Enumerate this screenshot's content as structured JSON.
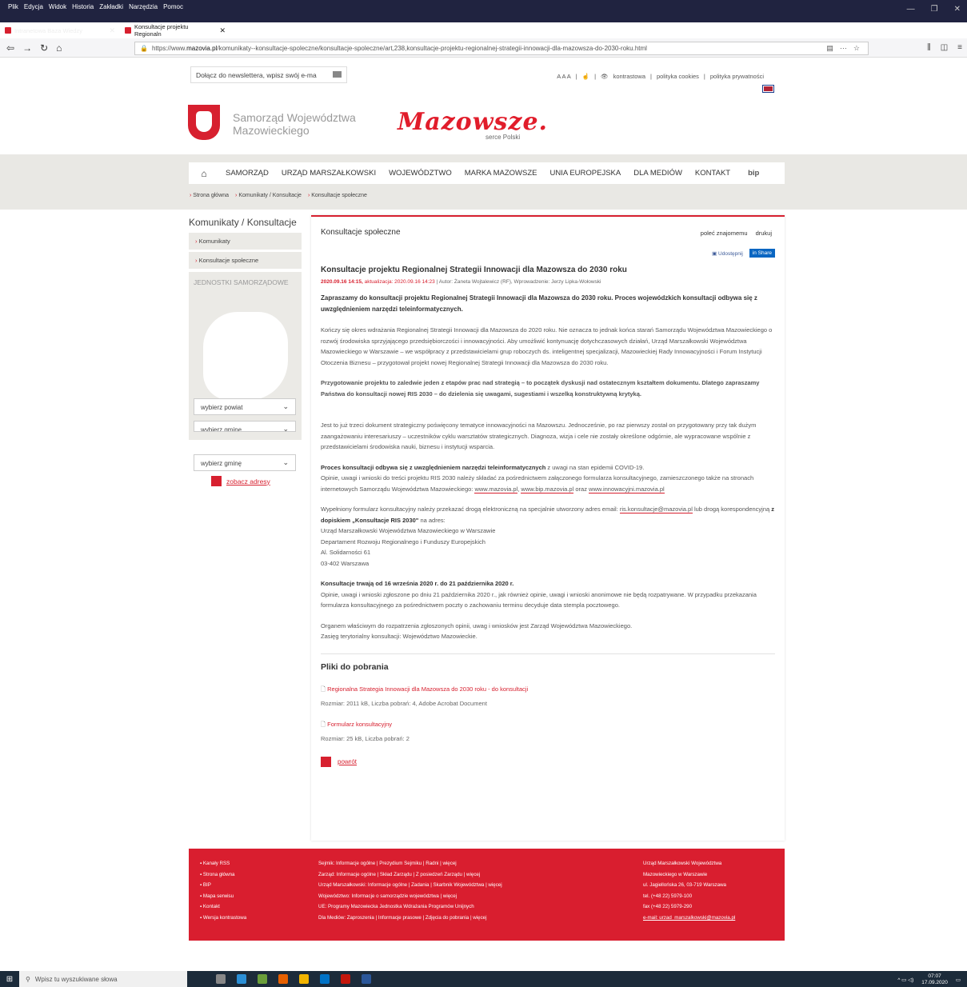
{
  "browser": {
    "menu": [
      "Plik",
      "Edycja",
      "Widok",
      "Historia",
      "Zakładki",
      "Narzędzia",
      "Pomoc"
    ],
    "tabs": [
      {
        "title": "Intranetowa Baza Wiedzy"
      },
      {
        "title": "Konsultacje projektu Regionaln"
      }
    ],
    "url_prefix": "https://www.",
    "url_host": "mazovia.pl",
    "url_rest": "/komunikaty--konsultacje-spoleczne/konsultacje-spoleczne/art,238,konsultacje-projektu-regionalnej-strategii-innowacji-dla-mazowsza-do-2030-roku.html"
  },
  "topbar": {
    "newsletter_placeholder": "Dołącz do newslettera, wpisz swój e-ma",
    "font_sizes": "A A A",
    "contrast": "kontrastowa",
    "cookies": "polityka cookies",
    "privacy": "polityka prywatności"
  },
  "logo": {
    "line1": "Samorząd Województwa",
    "line2": "Mazowieckiego",
    "brand": "Mazowsze.",
    "tagline": "serce Polski"
  },
  "mainmenu": [
    "SAMORZĄD",
    "URZĄD MARSZAŁKOWSKI",
    "WOJEWÓDZTWO",
    "MARKA MAZOWSZE",
    "UNIA EUROPEJSKA",
    "DLA MEDIÓW",
    "KONTAKT"
  ],
  "mainmenu_bip": "bip",
  "breadcrumb": [
    "Strona główna",
    "Komunikaty / Konsultacje",
    "Konsultacje społeczne"
  ],
  "sidebar": {
    "title": "Komunikaty / Konsultacje",
    "items": [
      "Komunikaty",
      "Konsultacje społeczne"
    ],
    "units_title": "JEDNOSTKI SAMORZĄDOWE",
    "select_powiat": "wybierz powiat",
    "select_gmina": "wybierz gminę",
    "show_addresses": "zobacz adresy"
  },
  "article": {
    "section": "Konsultacje społeczne",
    "recommend": "poleć znajomemu",
    "print": "drukuj",
    "fb_share": "Udostępnij",
    "li_share": "Share",
    "title": "Konsultacje projektu Regionalnej Strategii Innowacji dla Mazowsza do 2030 roku",
    "date": "2020.09.16 14:15,",
    "updated": "aktualizacja: 2020.09.16 14:23",
    "author": "| Autor: Żaneta Wojtalewicz (RF), Wprowadzenie: Jerzy Lipka-Wołowski",
    "lead": "Zapraszamy do konsultacji projektu Regionalnej Strategii Innowacji dla Mazowsza do 2030 roku. Proces wojewódzkich konsultacji odbywa się z uwzględnieniem narzędzi teleinformatycznych.",
    "p1": "Kończy się okres wdrażania Regionalnej Strategii Innowacji dla Mazowsza do 2020 roku. Nie oznacza to jednak końca starań Samorządu Województwa Mazowieckiego o rozwój środowiska sprzyjającego przedsiębiorczości i innowacyjności. Aby umożliwić kontynuację dotychczasowych działań, Urząd Marszałkowski Województwa Mazowieckiego w Warszawie – we współpracy z przedstawicielami grup roboczych ds. inteligentnej specjalizacji, Mazowieckiej Rady Innowacyjności i Forum Instytucji Otoczenia Biznesu – przygotował projekt nowej Regionalnej Strategii Innowacji dla Mazowsza do 2030 roku.",
    "p2": "Przygotowanie projektu to zaledwie jeden z etapów prac nad strategią – to początek dyskusji nad ostatecznym kształtem dokumentu. Dlatego zapraszamy Państwa do konsultacji nowej RIS 2030 – do dzielenia się uwagami, sugestiami i wszelką konstruktywną krytyką.",
    "p3": "Jest to już trzeci dokument strategiczny poświęcony tematyce innowacyjności na Mazowszu. Jednocześnie, po raz pierwszy został on przygotowany przy tak dużym zaangażowaniu interesariuszy – uczestników cyklu warsztatów strategicznych. Diagnoza, wizja i cele nie zostały określone odgórnie, ale wypracowane wspólnie z przedstawicielami środowiska nauki, biznesu i instytucji wsparcia.",
    "p4_bold": "Proces konsultacji odbywa się z uwzględnieniem narzędzi teleinformatycznych",
    "p4_rest": " z uwagi na stan epidemii COVID-19.",
    "p4_line2": "Opinie, uwagi i wnioski do treści projektu RIS 2030 należy składać za pośrednictwem załączonego formularza konsultacyjnego, zamieszczonego także na stronach internetowych Samorządu Województwa Mazowieckiego: ",
    "link1": "www.mazovia.pl",
    "link2": "www.bip.mazovia.pl",
    "link_oraz": " oraz",
    "link3": "www.innowacyjni.mazovia.pl",
    "p5_a": "Wypełniony formularz konsultacyjny należy przekazać drogą elektroniczną na specjalnie utworzony adres email: ",
    "email": "ris.konsultacje@mazovia.pl",
    "p5_b": " lub drogą korespondencyjną ",
    "p5_bold": "z dopiskiem „Konsultacje RIS 2030\"",
    "p5_c": " na adres:",
    "addr1": "Urząd Marszałkowski Województwa Mazowieckiego w Warszawie",
    "addr2": "Departament Rozwoju Regionalnego i Funduszy Europejskich",
    "addr3": "Al. Solidarności 61",
    "addr4": "03-402 Warszawa",
    "p6_bold": "Konsultacje trwają od 16 września 2020 r. do 21 października 2020 r.",
    "p6": "Opinie, uwagi i wnioski zgłoszone po dniu 21 października 2020 r., jak również opinie, uwagi i wnioski  anonimowe nie będą rozpatrywane. W przypadku przekazania formularza konsultacyjnego za pośrednictwem poczty o zachowaniu terminu decyduje data stempla pocztowego.",
    "p7a": "Organem właściwym do rozpatrzenia zgłoszonych opinii, uwag i wniosków jest Zarząd Województwa Mazowieckiego.",
    "p7b": "Zasięg terytorialny konsultacji: Województwo Mazowieckie.",
    "files_title": "Pliki do pobrania",
    "file1_name": "Regionalna Strategia Innowacji dla Mazowsza do 2030 roku - do konsultacji",
    "file1_info": "Rozmiar: 2011 kB, Liczba pobrań: 4, Adobe Acrobat Document",
    "file2_name": "Formularz konsultacyjny",
    "file2_info": "Rozmiar: 25 kB, Liczba pobrań: 2",
    "back": "powrót"
  },
  "footer": {
    "col1": [
      "Kanały RSS",
      "Strona główna",
      "BIP",
      "Mapa serwisu",
      "Kontakt",
      "Wersja kontrastowa"
    ],
    "col2": [
      "Sejmik: Informacje ogólne | Prezydium Sejmiku | Radni | więcej",
      "Zarząd: Informacje ogólne | Skład Zarządu | Z posiedzeń Zarządu | więcej",
      "Urząd Marszałkowski: Informacje ogólne | Zadania | Skarbnik Województwa | więcej",
      "Województwo: Informacje o samorządzie województwa | więcej",
      "UE: Programy Mazowiecka Jednostka Wdrażania Programów Unijnych",
      "Dla Mediów: Zaproszenia | Informacje prasowe | Zdjęcia do pobrania | więcej"
    ],
    "col3": [
      "Urząd Marszałkowski Województwa",
      "Mazowieckiego w Warszawie",
      "ul. Jagiellońska 26, 03-719 Warszawa",
      "tel. (+48 22) 5979-100",
      "fax (+48 22) 5979-290",
      "e-mail: urzad_marszalkowski@mazovia.pl"
    ]
  },
  "taskbar": {
    "search_placeholder": "Wpisz tu wyszukiwane słowa",
    "time": "07:07",
    "date": "17.09.2020"
  }
}
